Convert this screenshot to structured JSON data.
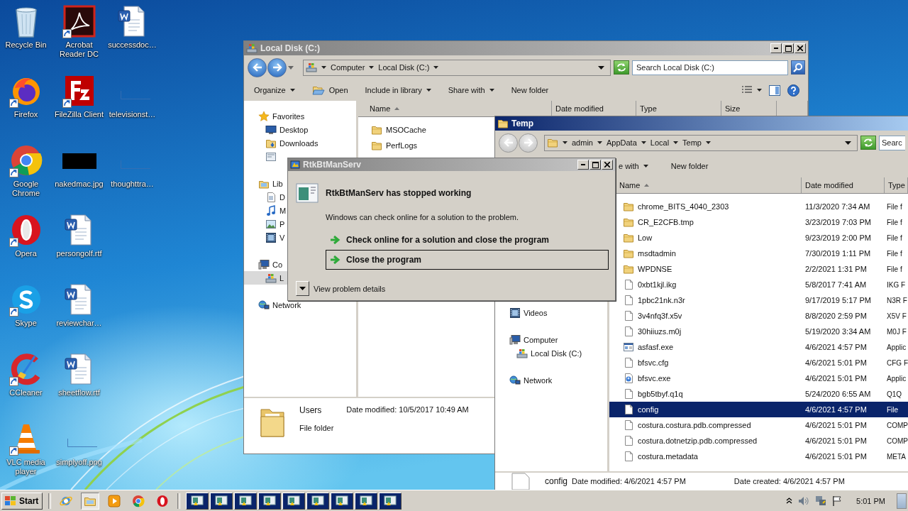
{
  "desktop_icons": [
    {
      "label": "Recycle Bin",
      "kind": "recycle",
      "shortcut": false
    },
    {
      "label": "Firefox",
      "kind": "firefox",
      "shortcut": true
    },
    {
      "label": "Google Chrome",
      "kind": "chrome",
      "shortcut": true
    },
    {
      "label": "Opera",
      "kind": "opera",
      "shortcut": true
    },
    {
      "label": "Skype",
      "kind": "skype",
      "shortcut": true
    },
    {
      "label": "CCleaner",
      "kind": "ccleaner",
      "shortcut": true
    },
    {
      "label": "VLC media player",
      "kind": "vlc",
      "shortcut": true
    },
    {
      "label": "Acrobat Reader DC",
      "kind": "acrobat",
      "shortcut": true
    },
    {
      "label": "FileZilla Client",
      "kind": "filezilla",
      "shortcut": true
    },
    {
      "label": "nakedmac.jpg",
      "kind": "black_image",
      "shortcut": false
    },
    {
      "label": "persongolf.rtf",
      "kind": "word",
      "shortcut": false
    },
    {
      "label": "reviewchar…",
      "kind": "word",
      "shortcut": false
    },
    {
      "label": "sheetflow.rtf",
      "kind": "word",
      "shortcut": false
    },
    {
      "label": "simplyoff.png",
      "kind": "blank",
      "shortcut": false
    },
    {
      "label": "successdoc…",
      "kind": "word",
      "shortcut": false
    },
    {
      "label": "televisionst…",
      "kind": "blank",
      "shortcut": false
    },
    {
      "label": "thoughttra…",
      "kind": "blank",
      "shortcut": false
    }
  ],
  "local_disk_window": {
    "title": "Local Disk (C:)",
    "active": false,
    "nav_enabled": true,
    "breadcrumb": [
      "Computer",
      "Local Disk (C:)"
    ],
    "search": {
      "placeholder": "Search Local Disk (C:)"
    },
    "toolbar": [
      {
        "label": "Organize",
        "kind": "dropdown"
      },
      {
        "label": "Open",
        "kind": "icon"
      },
      {
        "label": "Include in library",
        "kind": "dropdown"
      },
      {
        "label": "Share with",
        "kind": "dropdown"
      },
      {
        "label": "New folder",
        "kind": "plain"
      }
    ],
    "nav": [
      {
        "label": "Favorites",
        "kind": "star",
        "selected": false,
        "children": [
          {
            "label": "Desktop",
            "kind": "desktop",
            "selected": false
          },
          {
            "label": "Downloads",
            "kind": "downloads",
            "selected": false
          },
          {
            "kind": "recent",
            "selected": false
          }
        ]
      },
      {
        "label": "Lib",
        "kind": "libraries",
        "selected": false,
        "children": [
          {
            "label": "D",
            "kind": "documents",
            "selected": false
          },
          {
            "label": "M",
            "kind": "music",
            "selected": false
          },
          {
            "label": "P",
            "kind": "pictures",
            "selected": false
          },
          {
            "label": "V",
            "kind": "videos",
            "selected": false
          }
        ]
      },
      {
        "label": "Co",
        "kind": "computer",
        "selected": false,
        "children": [
          {
            "label": "L",
            "kind": "drive",
            "selected": true
          }
        ]
      },
      {
        "label": "Network",
        "kind": "network",
        "selected": false
      }
    ],
    "columns": [
      {
        "label": "Name",
        "sorted": true
      },
      {
        "label": "Date modified",
        "sorted": false
      },
      {
        "label": "Type",
        "sorted": false
      },
      {
        "label": "Size",
        "sorted": false
      }
    ],
    "rows": [
      {
        "name": "MSOCache",
        "kind": "folder",
        "selected": false
      },
      {
        "name": "PerfLogs",
        "kind": "folder",
        "selected": false
      }
    ],
    "details": {
      "name": "Users",
      "kind": "folder",
      "lines": [
        "Date modified: 10/5/2017 10:49 AM",
        "File folder"
      ]
    }
  },
  "temp_window": {
    "title": "Temp",
    "active": true,
    "nav_enabled": false,
    "breadcrumb": [
      "admin",
      "AppData",
      "Local",
      "Temp"
    ],
    "search": {
      "placeholder": "Searc"
    },
    "toolbar": [
      {
        "label": "e with",
        "kind": "dropdown"
      },
      {
        "label": "New folder",
        "kind": "plain"
      }
    ],
    "nav": [
      {
        "label": "Videos",
        "kind": "videos",
        "selected": false
      },
      {
        "label": "Computer",
        "kind": "computer",
        "selected": false,
        "children": [
          {
            "label": "Local Disk (C:)",
            "kind": "drive",
            "selected": false
          }
        ]
      },
      {
        "label": "Network",
        "kind": "network",
        "selected": false
      }
    ],
    "columns": [
      {
        "label": "Name",
        "sorted": true
      },
      {
        "label": "Date modified",
        "sorted": false
      },
      {
        "label": "Type",
        "sorted": false
      }
    ],
    "rows": [
      {
        "name": "chrome_BITS_4040_2303",
        "date": "11/3/2020 7:34 AM",
        "type": "File f",
        "kind": "folder",
        "selected": false
      },
      {
        "name": "CR_E2CFB.tmp",
        "date": "3/23/2019 7:03 PM",
        "type": "File f",
        "kind": "folder",
        "selected": false
      },
      {
        "name": "Low",
        "date": "9/23/2019 2:00 PM",
        "type": "File f",
        "kind": "folder",
        "selected": false
      },
      {
        "name": "msdtadmin",
        "date": "7/30/2019 1:11 PM",
        "type": "File f",
        "kind": "folder",
        "selected": false
      },
      {
        "name": "WPDNSE",
        "date": "2/2/2021 1:31 PM",
        "type": "File f",
        "kind": "folder",
        "selected": false
      },
      {
        "name": "0xbt1kjl.ikg",
        "date": "5/8/2017 7:41 AM",
        "type": "IKG F",
        "kind": "file",
        "selected": false
      },
      {
        "name": "1pbc21nk.n3r",
        "date": "9/17/2019 5:17 PM",
        "type": "N3R F",
        "kind": "file",
        "selected": false
      },
      {
        "name": "3v4nfq3f.x5v",
        "date": "8/8/2020 2:59 PM",
        "type": "X5V F",
        "kind": "file",
        "selected": false
      },
      {
        "name": "30hiiuzs.m0j",
        "date": "5/19/2020 3:34 AM",
        "type": "M0J F",
        "kind": "file",
        "selected": false
      },
      {
        "name": "asfasf.exe",
        "date": "4/6/2021 4:57 PM",
        "type": "Applic",
        "kind": "exe",
        "selected": false
      },
      {
        "name": "bfsvc.cfg",
        "date": "4/6/2021 5:01 PM",
        "type": "CFG F",
        "kind": "file",
        "selected": false
      },
      {
        "name": "bfsvc.exe",
        "date": "4/6/2021 5:01 PM",
        "type": "Applic",
        "kind": "appexe",
        "selected": false
      },
      {
        "name": "bgb5tbyf.q1q",
        "date": "5/24/2020 6:55 AM",
        "type": "Q1Q",
        "kind": "file",
        "selected": false
      },
      {
        "name": "config",
        "date": "4/6/2021 4:57 PM",
        "type": "File",
        "kind": "file",
        "selected": true
      },
      {
        "name": "costura.costura.pdb.compressed",
        "date": "4/6/2021 5:01 PM",
        "type": "COMP",
        "kind": "file",
        "selected": false
      },
      {
        "name": "costura.dotnetzip.pdb.compressed",
        "date": "4/6/2021 5:01 PM",
        "type": "COMP",
        "kind": "file",
        "selected": false
      },
      {
        "name": "costura.metadata",
        "date": "4/6/2021 5:01 PM",
        "type": "META",
        "kind": "file",
        "selected": false
      }
    ],
    "details": {
      "name": "config",
      "kind": "file",
      "lines": [
        "Date modified: 4/6/2021 4:57 PM",
        "Date created: 4/6/2021 4:57 PM"
      ]
    }
  },
  "dialog": {
    "title": "RtkBtManServ",
    "active": false,
    "heading": "RtkBtManServ has stopped working",
    "message": "Windows can check online for a solution to the problem.",
    "options": [
      {
        "label": "Check online for a solution and close the program",
        "focused": false
      },
      {
        "label": "Close the program",
        "focused": true
      }
    ],
    "details_toggle": "View problem details"
  },
  "taskbar": {
    "start": "Start",
    "quick_launch": [
      {
        "kind": "ie",
        "selected": false
      },
      {
        "kind": "explorer",
        "selected": true
      },
      {
        "kind": "media_player",
        "selected": false
      },
      {
        "kind": "chrome",
        "selected": false
      },
      {
        "kind": "opera",
        "selected": false
      }
    ],
    "tasks": [
      {
        "flashing": true
      },
      {
        "flashing": true
      },
      {
        "flashing": true
      },
      {
        "flashing": true
      },
      {
        "flashing": true
      },
      {
        "flashing": true
      },
      {
        "flashing": true
      },
      {
        "flashing": true
      },
      {
        "flashing": true
      }
    ],
    "clock": "5:01 PM"
  }
}
